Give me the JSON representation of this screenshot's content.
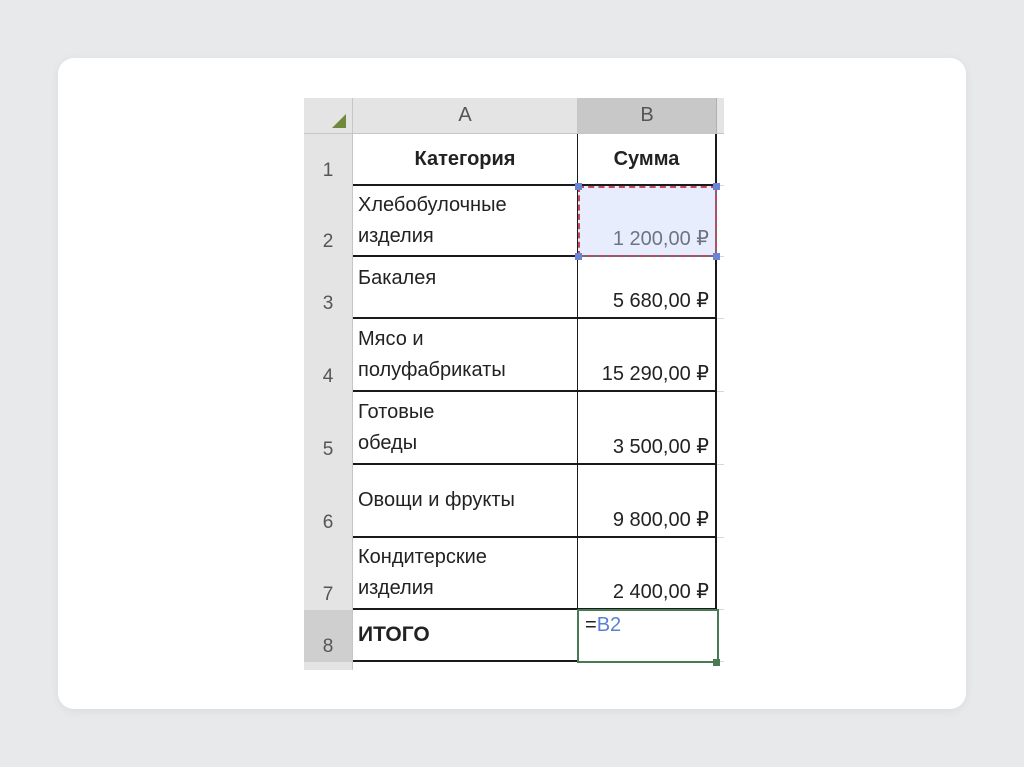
{
  "sheet": {
    "columns": [
      "A",
      "B"
    ],
    "header_row": {
      "row": "1",
      "a": "Категория",
      "b": "Сумма"
    },
    "rows": [
      {
        "row": "2",
        "a_lines": [
          "Хлебобулочные",
          "изделия"
        ],
        "b": "1 200,00 ₽"
      },
      {
        "row": "3",
        "a_lines": [
          "Бакалея"
        ],
        "b": "5 680,00 ₽"
      },
      {
        "row": "4",
        "a_lines": [
          "Мясо и",
          "полуфабрикаты"
        ],
        "b": "15 290,00 ₽"
      },
      {
        "row": "5",
        "a_lines": [
          "Готовые",
          "обеды"
        ],
        "b": "3 500,00 ₽"
      },
      {
        "row": "6",
        "a_lines": [
          "Овощи и фрукты"
        ],
        "b": "9 800,00 ₽"
      },
      {
        "row": "7",
        "a_lines": [
          "Кондитерские",
          "изделия"
        ],
        "b": "2 400,00 ₽"
      }
    ],
    "total_row": {
      "row": "8",
      "a": "ИТОГО",
      "formula_eq": "=",
      "formula_ref": "B2"
    }
  },
  "colors": {
    "active_cell_border": "#4a7a55",
    "reference_border": "#c4485a",
    "reference_text": "#5a7fd6"
  }
}
